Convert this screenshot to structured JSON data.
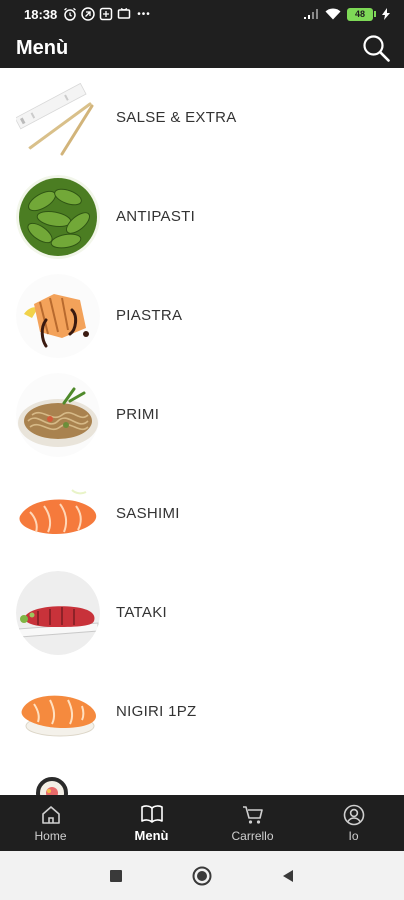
{
  "status_bar": {
    "time": "18:38",
    "more_indicator": "•••",
    "battery_level": "48"
  },
  "app_bar": {
    "title": "Menù",
    "search_icon": "search-icon"
  },
  "menu": {
    "items": [
      {
        "label": "SALSE & EXTRA",
        "icon": "chopsticks-image"
      },
      {
        "label": "ANTIPASTI",
        "icon": "edamame-image"
      },
      {
        "label": "PIASTRA",
        "icon": "grilled-salmon-image"
      },
      {
        "label": "PRIMI",
        "icon": "noodles-image"
      },
      {
        "label": "SASHIMI",
        "icon": "sashimi-image"
      },
      {
        "label": "TATAKI",
        "icon": "tataki-image"
      },
      {
        "label": "NIGIRI 1PZ",
        "icon": "nigiri-image"
      },
      {
        "label": "",
        "icon": "maki-image"
      }
    ]
  },
  "bottom_nav": {
    "items": [
      {
        "label": "Home",
        "icon": "home-icon",
        "active": false
      },
      {
        "label": "Menù",
        "icon": "book-icon",
        "active": true
      },
      {
        "label": "Carrello",
        "icon": "cart-icon",
        "active": false
      },
      {
        "label": "Io",
        "icon": "user-icon",
        "active": false
      }
    ]
  },
  "system_nav": {
    "recents_icon": "square-icon",
    "home_icon": "circle-icon",
    "back_icon": "triangle-back-icon"
  },
  "colors": {
    "bar_background": "#1f1f1f",
    "battery": "#7ed957",
    "label_text": "#333333"
  }
}
